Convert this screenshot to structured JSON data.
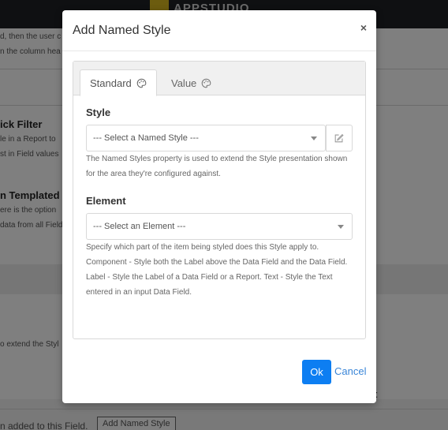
{
  "background": {
    "logo_text": "APPSTUDIO",
    "line1": "d, then the user c",
    "line2": "n the column hea",
    "heading1": "ick Filter",
    "line3": "le in a Report to",
    "line4": "st in Field values",
    "heading2": "n Templated",
    "line5": "ere is the option",
    "line6": "data from all Field",
    "line7": "o extend the Styl",
    "field_text": "n added to this Field.",
    "add_button_label": "Add Named Style",
    "right_char": "t"
  },
  "modal": {
    "title": "Add Named Style",
    "close_glyph": "×",
    "tabs": [
      {
        "label": "Standard",
        "icon": "palette-icon",
        "active": true
      },
      {
        "label": "Value",
        "icon": "palette-icon",
        "active": false
      }
    ],
    "style": {
      "label": "Style",
      "placeholder": "--- Select a Named Style ---",
      "help": "The Named Styles property is used to extend the Style presentation shown for the area they're configured against."
    },
    "element": {
      "label": "Element",
      "placeholder": "--- Select an Element ---",
      "help": "Specify which part of the item being styled does this Style apply to. Component - Style both the Label above the Data Field and the Data Field. Label - Style the Label of a Data Field or a Report. Text - Style the Text entered in an input Data Field."
    },
    "ok_label": "Ok",
    "cancel_label": "Cancel"
  },
  "colors": {
    "primary": "#0d7ef2",
    "link": "#3a86d8",
    "overlay": "rgba(0,0,0,0.5)"
  }
}
